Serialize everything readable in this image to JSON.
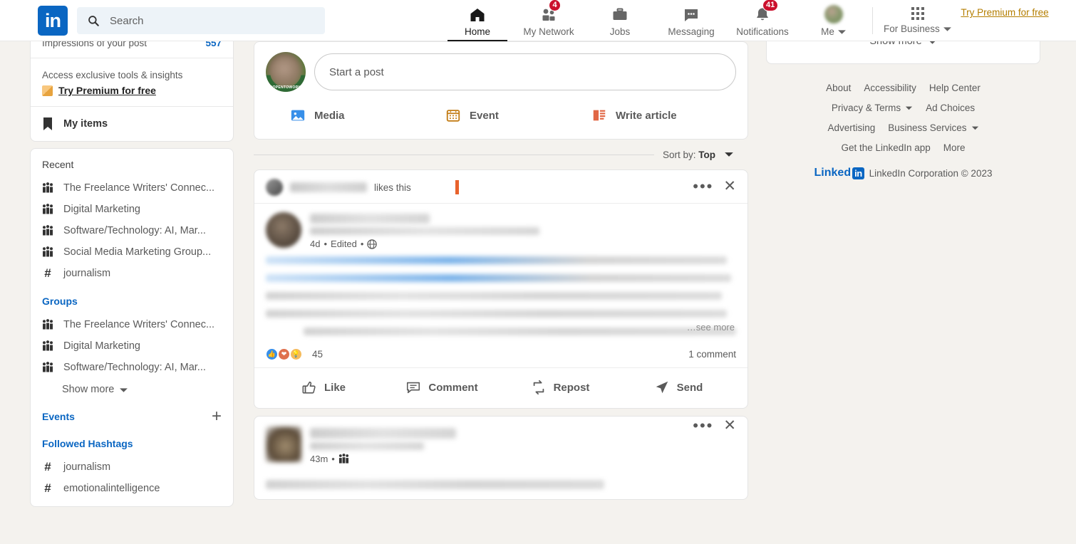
{
  "header": {
    "logo_text": "in",
    "search": {
      "placeholder": "Search",
      "value": "",
      "icon": "search-icon"
    },
    "nav": [
      {
        "label": "Home",
        "icon": "home-icon",
        "active": true,
        "badge": ""
      },
      {
        "label": "My Network",
        "icon": "people-icon",
        "active": false,
        "badge": "4"
      },
      {
        "label": "Jobs",
        "icon": "briefcase-icon",
        "active": false,
        "badge": ""
      },
      {
        "label": "Messaging",
        "icon": "message-icon",
        "active": false,
        "badge": ""
      },
      {
        "label": "Notifications",
        "icon": "bell-icon",
        "active": false,
        "badge": "41"
      }
    ],
    "me": {
      "label": "Me",
      "icon": "avatar"
    },
    "for_business": {
      "label": "For Business",
      "icon": "grid-icon"
    },
    "premium_link": "Try Premium for free"
  },
  "sidebar": {
    "impressions": {
      "label": "Impressions of your post",
      "count": "557"
    },
    "promo": {
      "subtitle": "Access exclusive tools & insights",
      "link": "Try Premium for free"
    },
    "my_items": {
      "label": "My items",
      "icon": "bookmark-icon"
    },
    "recent": {
      "title": "Recent",
      "items": [
        {
          "label": "The Freelance Writers' Connec...",
          "icon": "group-icon"
        },
        {
          "label": "Digital Marketing",
          "icon": "group-icon"
        },
        {
          "label": "Software/Technology: AI, Mar...",
          "icon": "group-icon"
        },
        {
          "label": "Social Media Marketing Group...",
          "icon": "group-icon"
        },
        {
          "label": "journalism",
          "icon": "hashtag-icon"
        }
      ]
    },
    "groups": {
      "title": "Groups",
      "items": [
        {
          "label": "The Freelance Writers' Connec...",
          "icon": "group-icon"
        },
        {
          "label": "Digital Marketing",
          "icon": "group-icon"
        },
        {
          "label": "Software/Technology: AI, Mar...",
          "icon": "group-icon"
        }
      ],
      "show_more": "Show more"
    },
    "events": {
      "title": "Events",
      "add_label": "+"
    },
    "hashtags": {
      "title": "Followed Hashtags",
      "items": [
        {
          "label": "journalism",
          "icon": "hashtag-icon"
        },
        {
          "label": "emotionalintelligence",
          "icon": "hashtag-icon"
        }
      ]
    }
  },
  "composer": {
    "placeholder": "Start a post",
    "avatar_frame_text": "#OPENTOWORK",
    "actions": [
      {
        "label": "Media",
        "icon": "image-icon"
      },
      {
        "label": "Event",
        "icon": "calendar-icon"
      },
      {
        "label": "Write article",
        "icon": "article-icon"
      }
    ]
  },
  "sort": {
    "prefix": "Sort by:",
    "value": "Top",
    "icon": "chevron-down-icon"
  },
  "feed": {
    "posts": [
      {
        "social_context": "likes this",
        "timestamp": "4d",
        "edited": "Edited",
        "visibility_icon": "globe-icon",
        "see_more": "…see more",
        "reactions": {
          "icons": [
            "like-icon",
            "love-icon",
            "insightful-icon"
          ],
          "count": "45"
        },
        "comments": "1 comment",
        "actions": [
          {
            "label": "Like",
            "icon": "thumbs-up-icon"
          },
          {
            "label": "Comment",
            "icon": "comment-icon"
          },
          {
            "label": "Repost",
            "icon": "repost-icon"
          },
          {
            "label": "Send",
            "icon": "send-icon"
          }
        ],
        "menu_icon": "more-options-icon",
        "close_icon": "close-icon"
      },
      {
        "timestamp": "43m",
        "visibility_icon": "group-icon",
        "menu_icon": "more-options-icon",
        "close_icon": "close-icon"
      }
    ]
  },
  "right_rail": {
    "show_more": "Show more",
    "footer_rows": [
      [
        {
          "label": "About"
        },
        {
          "label": "Accessibility"
        },
        {
          "label": "Help Center"
        }
      ],
      [
        {
          "label": "Privacy & Terms",
          "caret": true
        },
        {
          "label": "Ad Choices"
        }
      ],
      [
        {
          "label": "Advertising"
        },
        {
          "label": "Business Services",
          "caret": true
        }
      ],
      [
        {
          "label": "Get the LinkedIn app"
        },
        {
          "label": "More"
        }
      ]
    ],
    "copyright": "LinkedIn Corporation © 2023",
    "wordmark": {
      "text": "Linked",
      "box": "in"
    }
  },
  "colors": {
    "brand": "#0a66c2",
    "badge": "#cb112d",
    "premium": "#b47e00",
    "accent_orange": "#e8622c"
  }
}
